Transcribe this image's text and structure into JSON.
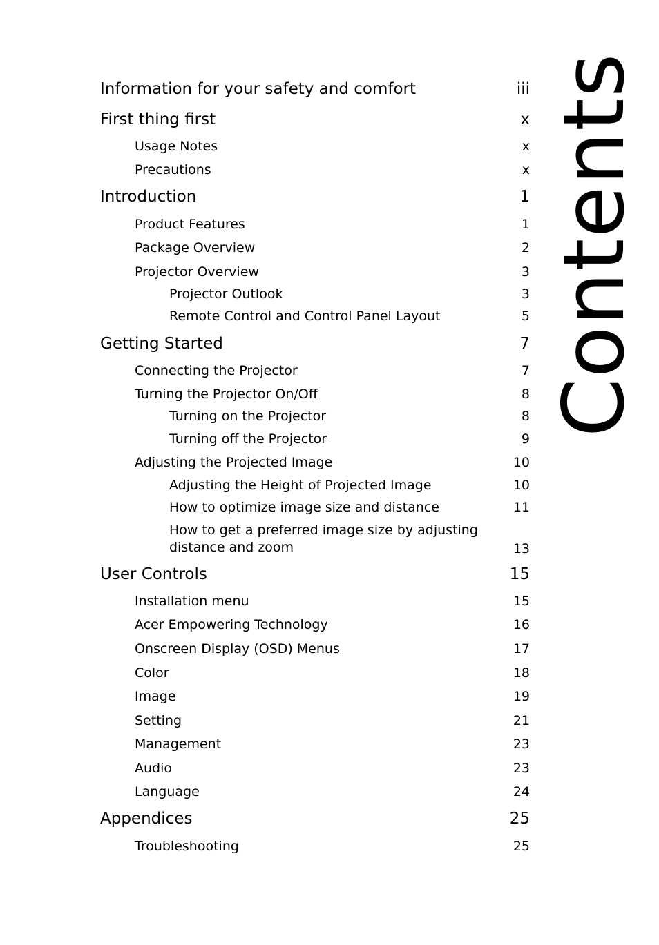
{
  "page_title": "Contents",
  "toc": [
    {
      "level": 1,
      "label": "Information for your safety and comfort",
      "page": "iii"
    },
    {
      "level": 1,
      "label": "First thing first",
      "page": "x"
    },
    {
      "level": 2,
      "label": "Usage Notes",
      "page": "x"
    },
    {
      "level": 2,
      "label": "Precautions",
      "page": "x"
    },
    {
      "level": 1,
      "label": "Introduction",
      "page": "1"
    },
    {
      "level": 2,
      "label": "Product Features",
      "page": "1"
    },
    {
      "level": 2,
      "label": "Package Overview",
      "page": "2"
    },
    {
      "level": 2,
      "label": "Projector Overview",
      "page": "3"
    },
    {
      "level": 3,
      "label": "Projector Outlook",
      "page": "3"
    },
    {
      "level": 3,
      "label": "Remote Control and Control Panel Layout",
      "page": "5"
    },
    {
      "level": 1,
      "label": "Getting Started",
      "page": "7"
    },
    {
      "level": 2,
      "label": "Connecting the Projector",
      "page": "7"
    },
    {
      "level": 2,
      "label": "Turning the Projector On/Off",
      "page": "8"
    },
    {
      "level": 3,
      "label": "Turning on the Projector",
      "page": "8"
    },
    {
      "level": 3,
      "label": "Turning off the Projector",
      "page": "9"
    },
    {
      "level": 2,
      "label": "Adjusting the Projected Image",
      "page": "10"
    },
    {
      "level": 3,
      "label": "Adjusting the Height of Projected Image",
      "page": "10"
    },
    {
      "level": 3,
      "label": "How to optimize image size and distance",
      "page": "11"
    },
    {
      "level": 3,
      "label": "How to get a preferred image size by adjusting distance and zoom",
      "page": "13"
    },
    {
      "level": 1,
      "label": "User Controls",
      "page": "15"
    },
    {
      "level": 2,
      "label": "Installation menu",
      "page": "15"
    },
    {
      "level": 2,
      "label": "Acer Empowering Technology",
      "page": "16"
    },
    {
      "level": 2,
      "label": "Onscreen Display (OSD) Menus",
      "page": "17"
    },
    {
      "level": 2,
      "label": "Color",
      "page": "18"
    },
    {
      "level": 2,
      "label": "Image",
      "page": "19"
    },
    {
      "level": 2,
      "label": "Setting",
      "page": "21"
    },
    {
      "level": 2,
      "label": "Management",
      "page": "23"
    },
    {
      "level": 2,
      "label": "Audio",
      "page": "23"
    },
    {
      "level": 2,
      "label": "Language",
      "page": "24"
    },
    {
      "level": 1,
      "label": "Appendices",
      "page": "25"
    },
    {
      "level": 2,
      "label": "Troubleshooting",
      "page": "25"
    }
  ]
}
